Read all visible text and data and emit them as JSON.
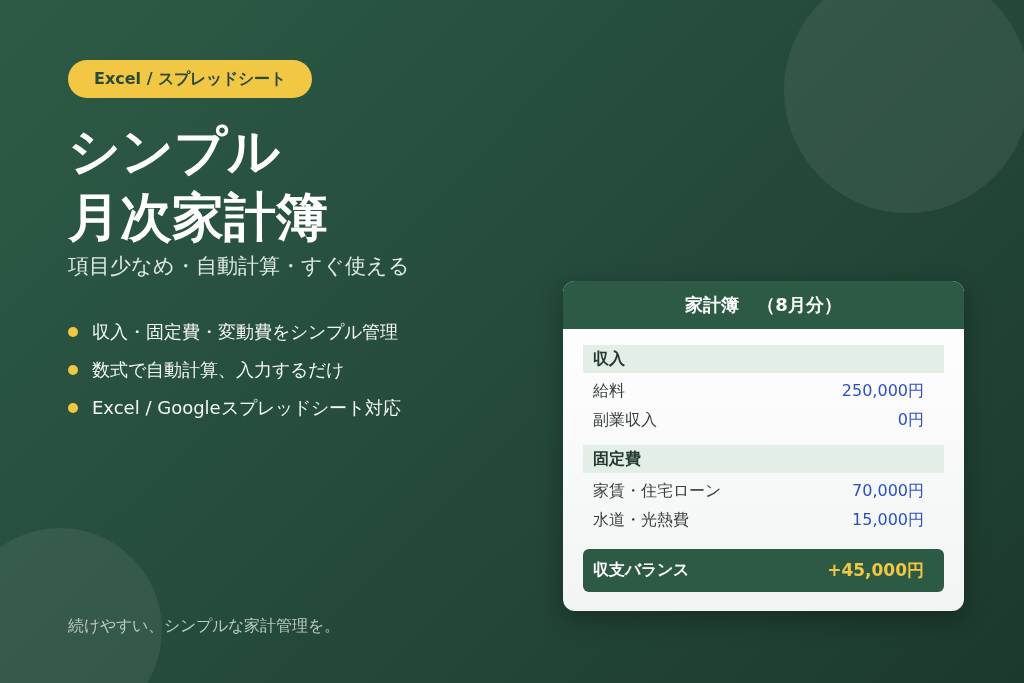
{
  "badge": "Excel / スプレッドシート",
  "title_lines": [
    "シンプル",
    "月次家計簿"
  ],
  "subtitle": "項目少なめ・自動計算・すぐ使える",
  "features": [
    "収入・固定費・変動費をシンプル管理",
    "数式で自動計算、入力するだけ",
    "Excel / Googleスプレッドシート対応"
  ],
  "footer": "続けやすい、シンプルな家計管理を。",
  "card": {
    "title": "家計簿　（8月分）",
    "sections": [
      {
        "heading": "収入",
        "rows": [
          {
            "label": "給料",
            "value": "250,000円"
          },
          {
            "label": "副業収入",
            "value": "0円"
          }
        ]
      },
      {
        "heading": "固定費",
        "rows": [
          {
            "label": "家賃・住宅ローン",
            "value": "70,000円"
          },
          {
            "label": "水道・光熱費",
            "value": "15,000円"
          }
        ]
      }
    ],
    "balance": {
      "label": "収支バランス",
      "value": "+45,000円"
    }
  }
}
